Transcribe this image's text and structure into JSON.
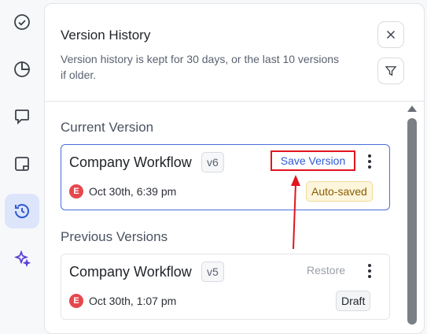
{
  "rail": {
    "items": [
      {
        "icon": "check-circle-icon",
        "active": false
      },
      {
        "icon": "pie-chart-icon",
        "active": false
      },
      {
        "icon": "comment-icon",
        "active": false
      },
      {
        "icon": "note-icon",
        "active": false
      },
      {
        "icon": "history-icon",
        "active": true
      },
      {
        "icon": "sparkles-icon",
        "active": false
      }
    ],
    "accent_color": "#5b3fd6",
    "active_bg": "#dde5fb"
  },
  "panel": {
    "title": "Version History",
    "subtitle": "Version history is kept for 30 days, or the last 10 versions if older.",
    "close_icon": "close-icon",
    "filter_icon": "filter-icon"
  },
  "current": {
    "section_title": "Current Version",
    "name": "Company Workflow",
    "version": "v6",
    "action_label": "Save Version",
    "avatar_letter": "E",
    "timestamp": "Oct 30th, 6:39 pm",
    "status": "Auto-saved"
  },
  "previous": {
    "section_title": "Previous Versions",
    "items": [
      {
        "name": "Company Workflow",
        "version": "v5",
        "action_label": "Restore",
        "avatar_letter": "E",
        "timestamp": "Oct 30th, 1:07 pm",
        "status": "Draft"
      }
    ]
  },
  "colors": {
    "highlight_box": "#e0161e",
    "link_blue": "#2f5bd3",
    "avatar_red": "#e5484d"
  }
}
